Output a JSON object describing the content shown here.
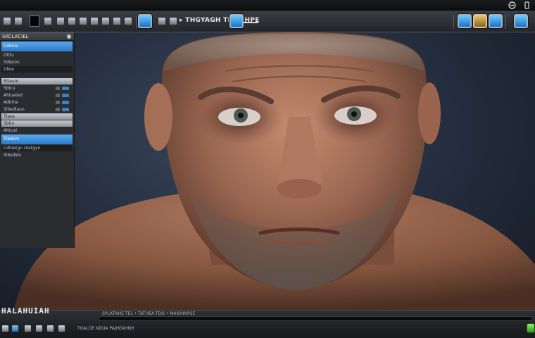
{
  "toolbar": {
    "title": "▸ THGYAGH TELIDHPE",
    "left_icons": [
      "select-icon",
      "move-icon",
      "text-icon",
      "brush-icon",
      "color-swatch-icon",
      "layer-icon",
      "grid-icon",
      "frame-icon",
      "camera-icon",
      "light-icon",
      "pen-icon"
    ],
    "right_icons": [
      "viewport-icon",
      "material-icon",
      "render-icon",
      "settings-icon"
    ]
  },
  "top_strip": {
    "controls": [
      "minimize-icon",
      "menu-icon"
    ]
  },
  "left_panel": {
    "header": "SKCLACIEL",
    "rows": [
      {
        "label": "Colone",
        "style": "sel"
      },
      {
        "label": "Dtltu",
        "style": "normal"
      },
      {
        "label": "Sdlaton",
        "style": "normal"
      },
      {
        "label": "Dlleu",
        "style": "dark"
      },
      {
        "label": "Rlteum",
        "style": "light"
      },
      {
        "label": "Sblcu",
        "style": "normal"
      },
      {
        "label": "Ahlueted",
        "style": "normal"
      },
      {
        "label": "Adlnhe",
        "style": "normal"
      },
      {
        "label": "Slhedlaun",
        "style": "normal"
      },
      {
        "label": "Tlpsa",
        "style": "light"
      },
      {
        "label": "Sbhn",
        "style": "light"
      },
      {
        "label": "Ahtusl",
        "style": "normal"
      },
      {
        "label": "Tlbdsnt",
        "style": "sel"
      },
      {
        "label": "Cdhletgn Uletgyn",
        "style": "normal"
      },
      {
        "label": "Slbsdlds",
        "style": "normal"
      }
    ]
  },
  "bottom_bar": {
    "timeline_label": "HALAHUIAH",
    "status": "SPLATNHE TEL • TATHEA TDO • MAIOHNPSE",
    "text": "TOALDE NDUA PAJHEAHNH"
  },
  "colors": {
    "accent_blue": "#2c79c6",
    "panel_bg": "#2a2c30",
    "toolbar_bg": "#3a3d42",
    "status_green": "#2f9a1e"
  }
}
